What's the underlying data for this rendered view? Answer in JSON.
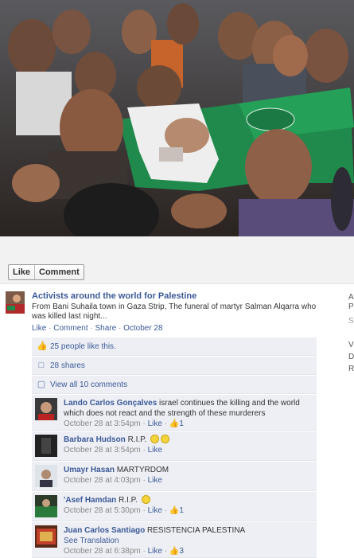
{
  "photo": {
    "alt_label": ""
  },
  "action_bar": {
    "like_label": "Like",
    "comment_label": "Comment"
  },
  "post": {
    "author": "Activists around the world for Palestine",
    "text": "From Bani Suhaila town in Gaza Strip, The funeral of martyr Salman Alqarra who was killed last night...",
    "like": "Like",
    "comment": "Comment",
    "share": "Share",
    "timestamp": "October 28"
  },
  "ufi": {
    "likes_text": "25 people like this.",
    "shares_text": "28 shares",
    "view_all_text": "View all 10 comments"
  },
  "comments": [
    {
      "name": "Lando Carlos Gonçalves",
      "text": "israel continues the killing and the world which does not react and the strength of these murderers",
      "time": "October 28 at 3:54pm",
      "like": "Like",
      "likes": "1"
    },
    {
      "name": "Barbara Hudson",
      "text": "R.I.P.",
      "time": "October 28 at 3:54pm",
      "like": "Like",
      "likes": ""
    },
    {
      "name": "Umayr Hasan",
      "text": "MARTYRDOM",
      "time": "October 28 at 4:03pm",
      "like": "Like",
      "likes": ""
    },
    {
      "name": "'Asef Hamdan",
      "text": "R.I.P.",
      "time": "October 28 at 5:30pm",
      "like": "Like",
      "likes": "1"
    },
    {
      "name": "Juan Carlos Santiago",
      "text": "RESISTENCIA PALESTINA",
      "see_translation": "See Translation",
      "time": "October 28 at 6:38pm",
      "like": "Like",
      "likes": "3"
    }
  ],
  "right_column": [
    "A",
    "P",
    "S",
    "V",
    "D",
    "R"
  ],
  "colors": {
    "link": "#3b5998",
    "ufi_bg": "#edeff4",
    "flag_green": "#1f8a4c"
  }
}
